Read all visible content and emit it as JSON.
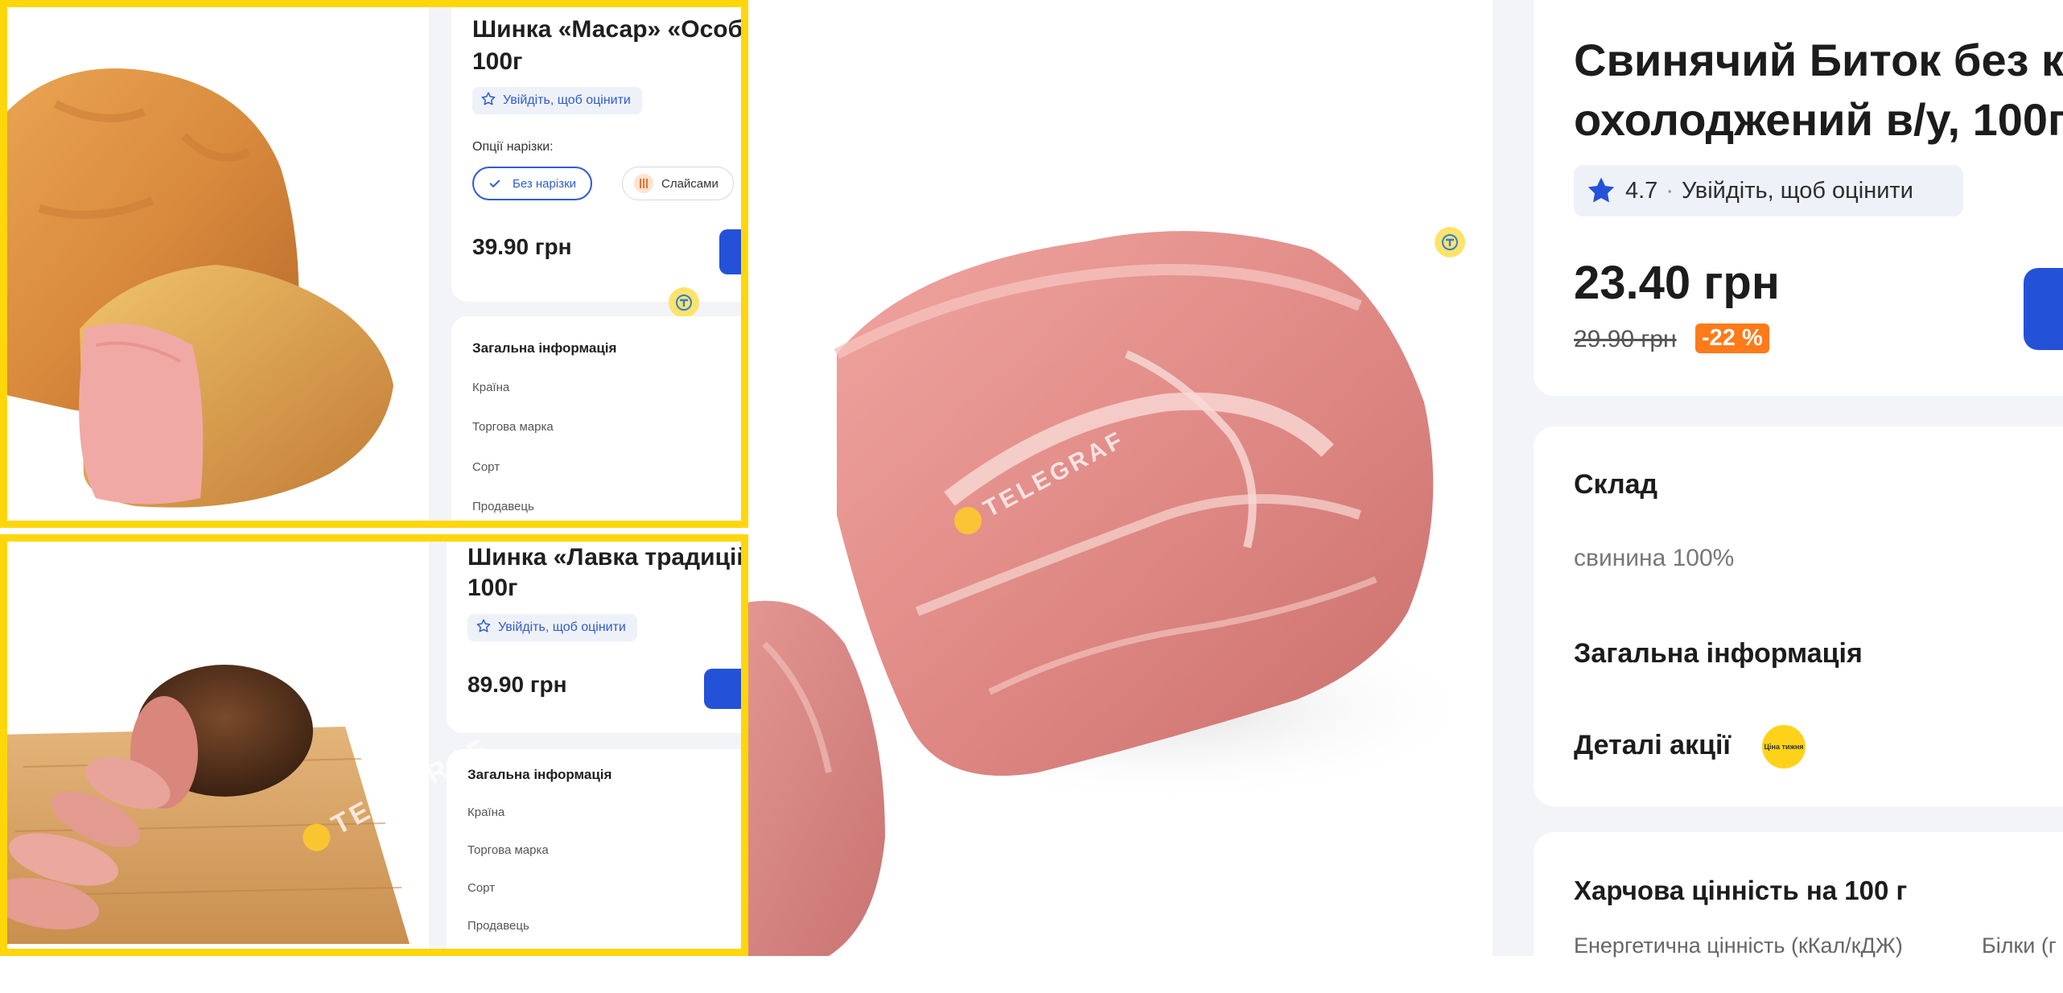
{
  "product_1": {
    "title_line1": "Шинка «Масар» «Особ",
    "title_line2": "100г",
    "rating_prompt": "Увійдіть, щоб оцінити",
    "slicing_label": "Опції нарізки:",
    "slicing_options": [
      "Без нарізки",
      "Слайсами"
    ],
    "price": "39.90 грн",
    "info_heading": "Загальна інформація",
    "info_rows": [
      "Країна",
      "Торгова марка",
      "Сорт",
      "Продавець"
    ]
  },
  "product_2": {
    "title_line1": "Шинка «Лавка традицій»",
    "title_line2": "100г",
    "rating_prompt": "Увійдіть, щоб оцінити",
    "price": "89.90 грн",
    "info_heading": "Загальна інформація",
    "info_rows": [
      "Країна",
      "Торгова марка",
      "Сорт",
      "Продавець"
    ]
  },
  "main_product": {
    "title_line1": "Свинячий Биток без кіс",
    "title_line2": "охолоджений в/у, 100г",
    "rating_value": "4.7",
    "rating_separator": "·",
    "rating_prompt": "Увійдіть, щоб оцінити",
    "price": "23.40 грн",
    "old_price": "29.90 грн",
    "discount": "-22 %",
    "composition_heading": "Склад",
    "composition_text": "свинина 100%",
    "general_info_heading": "Загальна інформація",
    "promo_heading": "Деталі акції",
    "promo_badge_text": "Ціна тижня",
    "nutrition_heading": "Харчова цінність на 100 г",
    "nutrition_columns": [
      "Енергетична цінність (кКал/кДЖ)",
      "Білки (г"
    ]
  },
  "watermark": {
    "text": "TELEGRAF"
  },
  "colors": {
    "frame_yellow": "#FFD60A",
    "accent_blue": "#2352d8",
    "discount_orange": "#ff7a1a",
    "page_gray": "#f3f4f8"
  },
  "icons": [
    "star-icon",
    "check-icon",
    "slices-icon",
    "telegraf-logo-icon"
  ]
}
